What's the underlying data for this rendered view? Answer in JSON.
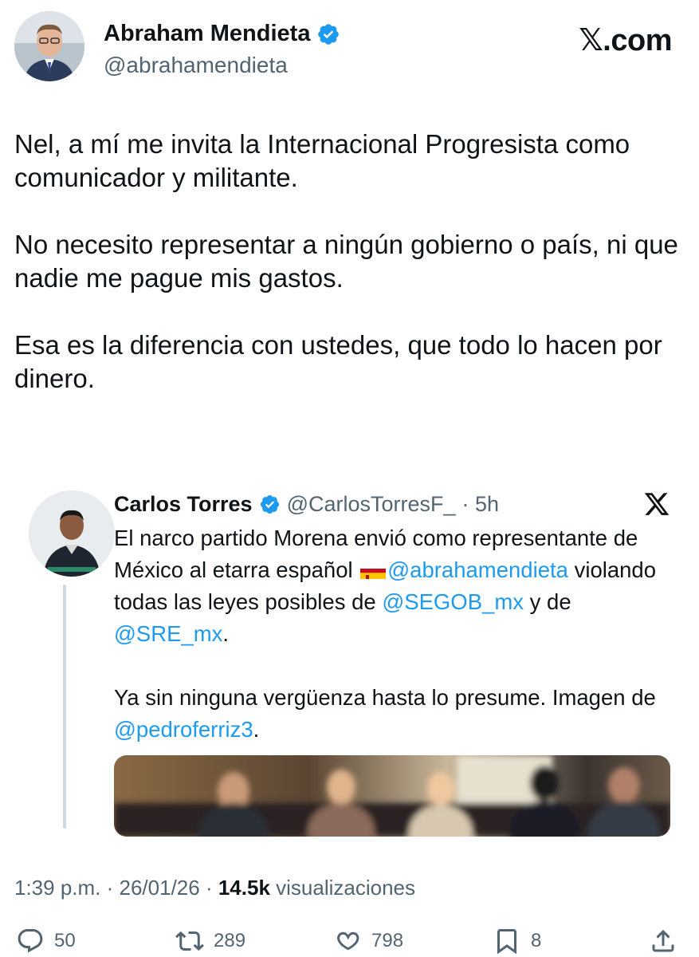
{
  "author": {
    "name": "Abraham Mendieta",
    "handle": "@abrahamendieta",
    "verified": true
  },
  "brand": "𝕏.com",
  "post": {
    "paragraphs": [
      "Nel, a mí me invita la Internacional Progresista como comunicador y militante.",
      "No necesito representar a ningún gobierno o país, ni que nadie me pague mis gastos.",
      "Esa es la diferencia con ustedes, que todo lo hacen por dinero."
    ]
  },
  "quoted": {
    "name": "Carlos Torres",
    "handle": "@CarlosTorresF_",
    "time": "· 5h",
    "line1": "El narco partido Morena envió como representante de México al etarra español ",
    "mention1": "@abrahamendieta",
    "line2": " violando todas las leyes posibles de ",
    "mention2": "@SEGOB_mx",
    "line3": " y de ",
    "mention3": "@SRE_mx",
    "line4": ".",
    "line5": "Ya sin ninguna vergüenza hasta lo presume. Imagen de ",
    "mention4": "@pedroferriz3",
    "line6": "."
  },
  "meta": {
    "time": "1:39 p.m.",
    "sep1": " · ",
    "date": "26/01/26",
    "sep2": " · ",
    "views": "14.5k",
    "views_label": " visualizaciones"
  },
  "actions": {
    "replies": "50",
    "reposts": "289",
    "likes": "798",
    "bookmarks": "8"
  },
  "colors": {
    "link": "#1d9bf0",
    "verified": "#1d9bf0",
    "muted": "#536471",
    "text": "#0f1419"
  },
  "icons": [
    "verified-badge-icon",
    "x-logo-icon",
    "reply-icon",
    "repost-icon",
    "like-icon",
    "bookmark-icon",
    "share-icon"
  ]
}
